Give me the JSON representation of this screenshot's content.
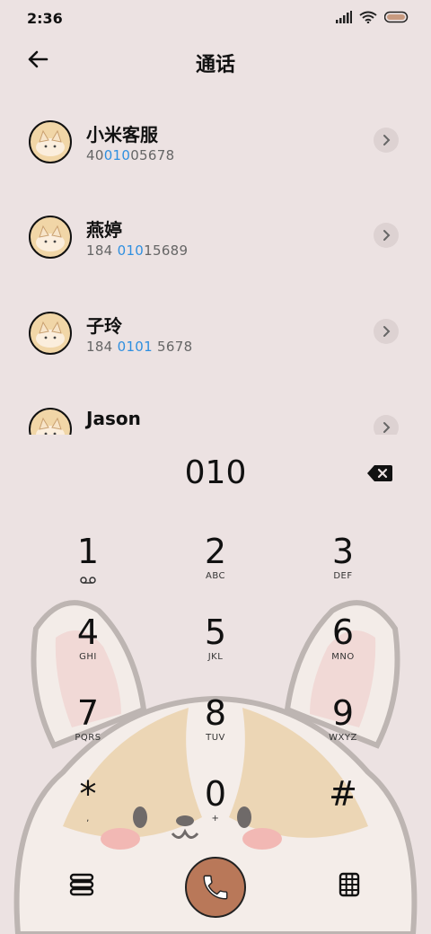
{
  "status_bar": {
    "time": "2:36",
    "battery_icon": "battery-icon",
    "wifi_icon": "wifi-icon",
    "signal_icon": "signal-icon"
  },
  "header": {
    "title": "通话",
    "back_icon": "back-arrow-icon"
  },
  "contacts": [
    {
      "name": "小米客服",
      "number_pre": "40",
      "number_match": "010",
      "number_post": "05678"
    },
    {
      "name": "燕婷",
      "number_pre": "184 ",
      "number_match": "010",
      "number_post": "15689"
    },
    {
      "name": "子玲",
      "number_pre": "184 ",
      "number_match": "0101",
      "number_post": " 5678"
    },
    {
      "name": "Jason",
      "number_pre": "",
      "number_match": "",
      "number_post": ""
    }
  ],
  "dialer": {
    "input": "010",
    "keys": [
      {
        "digit": "1",
        "letters": ""
      },
      {
        "digit": "2",
        "letters": "ABC"
      },
      {
        "digit": "3",
        "letters": "DEF"
      },
      {
        "digit": "4",
        "letters": "GHI"
      },
      {
        "digit": "5",
        "letters": "JKL"
      },
      {
        "digit": "6",
        "letters": "MNO"
      },
      {
        "digit": "7",
        "letters": "PQRS"
      },
      {
        "digit": "8",
        "letters": "TUV"
      },
      {
        "digit": "9",
        "letters": "WXYZ"
      },
      {
        "digit": "*",
        "letters": ","
      },
      {
        "digit": "0",
        "letters": "+"
      },
      {
        "digit": "#",
        "letters": ""
      }
    ]
  },
  "colors": {
    "background": "#ece2e2",
    "highlight": "#2f8fe0",
    "call_button": "#b97859"
  }
}
